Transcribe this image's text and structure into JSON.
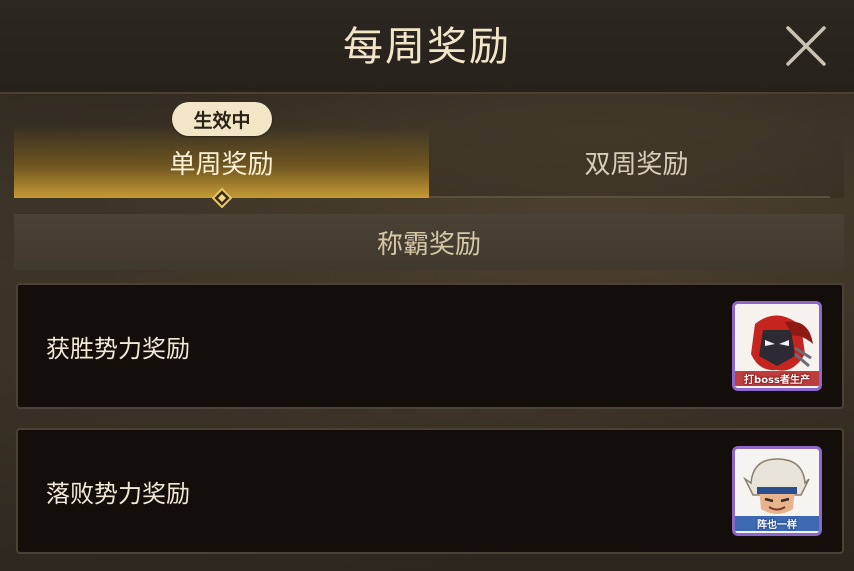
{
  "header": {
    "title": "每周奖励"
  },
  "close": {
    "icon": "close-icon"
  },
  "tabs": [
    {
      "label": "单周奖励",
      "active": true
    },
    {
      "label": "双周奖励",
      "active": false
    }
  ],
  "active_badge": "生效中",
  "section": {
    "title": "称霸奖励"
  },
  "rewards": [
    {
      "label": "获胜势力奖励",
      "icon": "boss-avatar-icon",
      "caption": "打boss者生产"
    },
    {
      "label": "落败势力奖励",
      "icon": "warrior-avatar-icon",
      "caption": "阵也一样"
    }
  ],
  "colors": {
    "accent_gold": "#c69a35",
    "frame_purple": "#8b68c9"
  }
}
